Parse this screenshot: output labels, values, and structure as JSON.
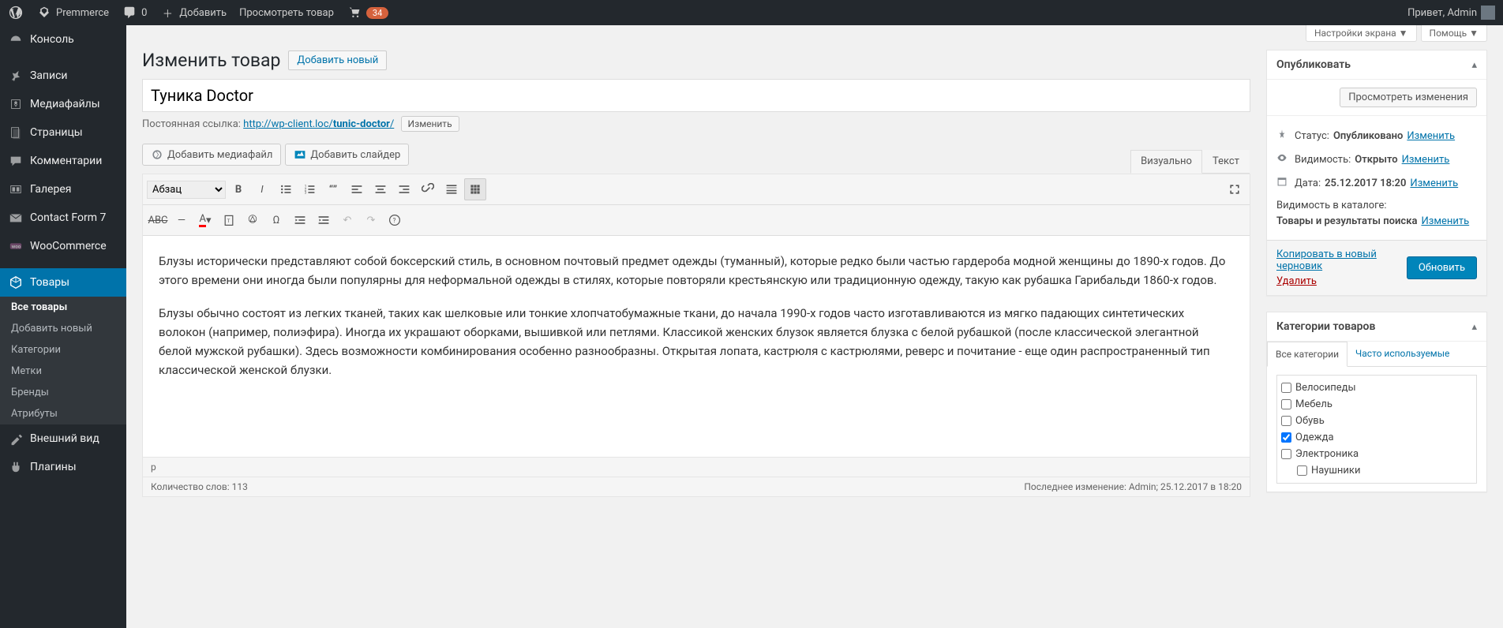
{
  "adminbar": {
    "site_name": "Premmerce",
    "comments_count": "0",
    "add_new": "Добавить",
    "view_product": "Просмотреть товар",
    "updates_count": "34",
    "greeting": "Привет, Admin"
  },
  "sidebar": {
    "items": [
      {
        "label": "Консоль",
        "icon": "dashboard"
      },
      {
        "label": "Записи",
        "icon": "pin"
      },
      {
        "label": "Медиафайлы",
        "icon": "media"
      },
      {
        "label": "Страницы",
        "icon": "pages"
      },
      {
        "label": "Комментарии",
        "icon": "comments"
      },
      {
        "label": "Галерея",
        "icon": "gallery"
      },
      {
        "label": "Contact Form 7",
        "icon": "mail"
      },
      {
        "label": "WooCommerce",
        "icon": "woo"
      },
      {
        "label": "Товары",
        "icon": "product",
        "active": true
      },
      {
        "label": "Внешний вид",
        "icon": "appearance"
      },
      {
        "label": "Плагины",
        "icon": "plugins"
      }
    ],
    "sub": [
      {
        "label": "Все товары",
        "active": true
      },
      {
        "label": "Добавить новый"
      },
      {
        "label": "Категории"
      },
      {
        "label": "Метки"
      },
      {
        "label": "Бренды"
      },
      {
        "label": "Атрибуты"
      }
    ]
  },
  "screen": {
    "options": "Настройки экрана",
    "help": "Помощь"
  },
  "page": {
    "heading": "Изменить товар",
    "add_new": "Добавить новый",
    "title": "Туника Doctor",
    "permalink_label": "Постоянная ссылка:",
    "permalink_base": "http://wp-client.loc/",
    "permalink_slug": "tunic-doctor",
    "permalink_trail": "/",
    "edit_btn": "Изменить"
  },
  "media": {
    "add_media": "Добавить медиафайл",
    "add_slider": "Добавить слайдер"
  },
  "editor": {
    "tab_visual": "Визуально",
    "tab_text": "Текст",
    "format_label": "Абзац",
    "content_p1": "Блузы исторически представляют собой боксерский стиль, в основном почтовый предмет одежды (туманный), которые редко были частью гардероба модной женщины до 1890-х годов. До этого времени они иногда были популярны для неформальной одежды в стилях, которые повторяли крестьянскую или традиционную одежду, такую как рубашка Гарибальди 1860-х годов.",
    "content_p2": "Блузы обычно состоят из легких тканей, таких как шелковые или тонкие хлопчатобумажные ткани, до начала 1990-х годов часто изготавливаются из мягко падающих синтетических волокон (например, полиэфира). Иногда их украшают оборками, вышивкой или петлями. Классикой женских блузок является блузка с белой рубашкой (после классической элегантной белой мужской рубашки). Здесь возможности комбинирования особенно разнообразны. Открытая лопата, кастрюля с кастрюлями, реверс и почитание - еще один распространенный тип классической женской блузки.",
    "path": "p",
    "word_count_label": "Количество слов:",
    "word_count": "113",
    "last_edit": "Последнее изменение: Admin; 25.12.2017 в 18:20"
  },
  "publish": {
    "box_title": "Опубликовать",
    "preview": "Просмотреть изменения",
    "status_label": "Статус:",
    "status_value": "Опубликовано",
    "visibility_label": "Видимость:",
    "visibility_value": "Открыто",
    "date_label": "Дата:",
    "date_value": "25.12.2017 18:20",
    "catalog_label": "Видимость в каталоге:",
    "catalog_value": "Товары и результаты поиска",
    "edit": "Изменить",
    "copy_draft": "Копировать в новый черновик",
    "delete": "Удалить",
    "update": "Обновить"
  },
  "categories": {
    "box_title": "Категории товаров",
    "tab_all": "Все категории",
    "tab_freq": "Часто используемые",
    "items": [
      {
        "label": "Велосипеды",
        "checked": false
      },
      {
        "label": "Мебель",
        "checked": false
      },
      {
        "label": "Обувь",
        "checked": false
      },
      {
        "label": "Одежда",
        "checked": true
      },
      {
        "label": "Электроника",
        "checked": false
      },
      {
        "label": "Наушники",
        "checked": false,
        "sub": true
      }
    ]
  }
}
